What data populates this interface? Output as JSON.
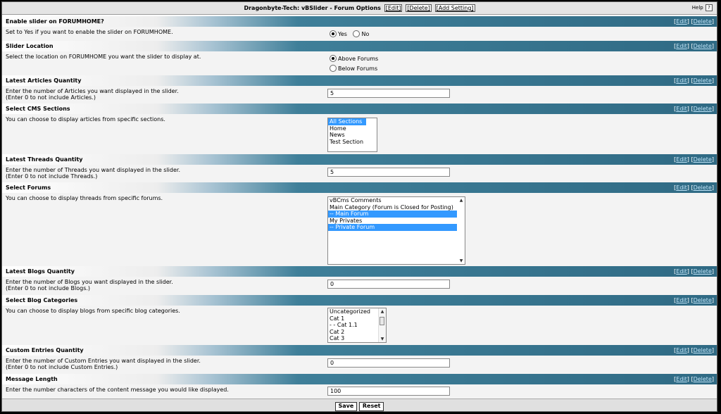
{
  "title": {
    "text": "Dragonbyte-Tech: vBSlider - Forum Options",
    "edit": "[Edit]",
    "delete": "[Delete]",
    "add_setting": "[Add Setting]",
    "help": "Help",
    "help_q": "?"
  },
  "actions": {
    "open": "[",
    "edit": "Edit",
    "mid": "] [",
    "delete": "Delete",
    "close": "]"
  },
  "settings": [
    {
      "title": "Enable slider on FORUMHOME?",
      "desc": "Set to Yes if you want to enable the slider on FORUMHOME.",
      "options": [
        {
          "label": "Yes",
          "checked": true
        },
        {
          "label": "No",
          "checked": false
        }
      ]
    },
    {
      "title": "Slider Location",
      "desc": "Select the location on FORUMHOME you want the slider to display at.",
      "options": [
        {
          "label": "Above Forums",
          "checked": true
        },
        {
          "label": "Below Forums",
          "checked": false
        }
      ]
    },
    {
      "title": "Latest Articles Quantity",
      "desc": "Enter the number of Articles you want displayed in the slider.",
      "desc2": "(Enter 0 to not include Articles.)",
      "value": "5"
    },
    {
      "title": "Select CMS Sections",
      "desc": "You can choose to display articles from specific sections.",
      "items": [
        {
          "label": "All Sections",
          "selected": true
        },
        {
          "label": "Home",
          "selected": false
        },
        {
          "label": "News",
          "selected": false
        },
        {
          "label": "Test Section",
          "selected": false
        }
      ]
    },
    {
      "title": "Latest Threads Quantity",
      "desc": "Enter the number of Threads you want displayed in the slider.",
      "desc2": "(Enter 0 to not include Threads.)",
      "value": "5"
    },
    {
      "title": "Select Forums",
      "desc": "You can choose to display threads from specific forums.",
      "items": [
        {
          "label": "vBCms Comments",
          "selected": false
        },
        {
          "label": "Main Category (Forum is Closed for Posting)",
          "selected": false
        },
        {
          "label": "-- Main Forum",
          "selected": true
        },
        {
          "label": "My Privates",
          "selected": false
        },
        {
          "label": "-- Private Forum",
          "selected": true
        }
      ]
    },
    {
      "title": "Latest Blogs Quantity",
      "desc": "Enter the number of Blogs you want displayed in the slider.",
      "desc2": "(Enter 0 to not include Blogs.)",
      "value": "0"
    },
    {
      "title": "Select Blog Categories",
      "desc": "You can choose to display blogs from specific blog categories.",
      "items": [
        {
          "label": "Uncategorized",
          "selected": false
        },
        {
          "label": "Cat 1",
          "selected": false
        },
        {
          "label": "- - Cat 1.1",
          "selected": false
        },
        {
          "label": "Cat 2",
          "selected": false
        },
        {
          "label": "Cat 3",
          "selected": false
        }
      ]
    },
    {
      "title": "Custom Entries Quantity",
      "desc": "Enter the number of Custom Entries you want displayed in the slider.",
      "desc2": "(Enter 0 to not include Custom Entries.)",
      "value": "0"
    },
    {
      "title": "Message Length",
      "desc": "Enter the number characters of the content message you would like displayed.",
      "value": "100"
    }
  ],
  "footer": {
    "save": "Save",
    "reset": "Reset"
  }
}
